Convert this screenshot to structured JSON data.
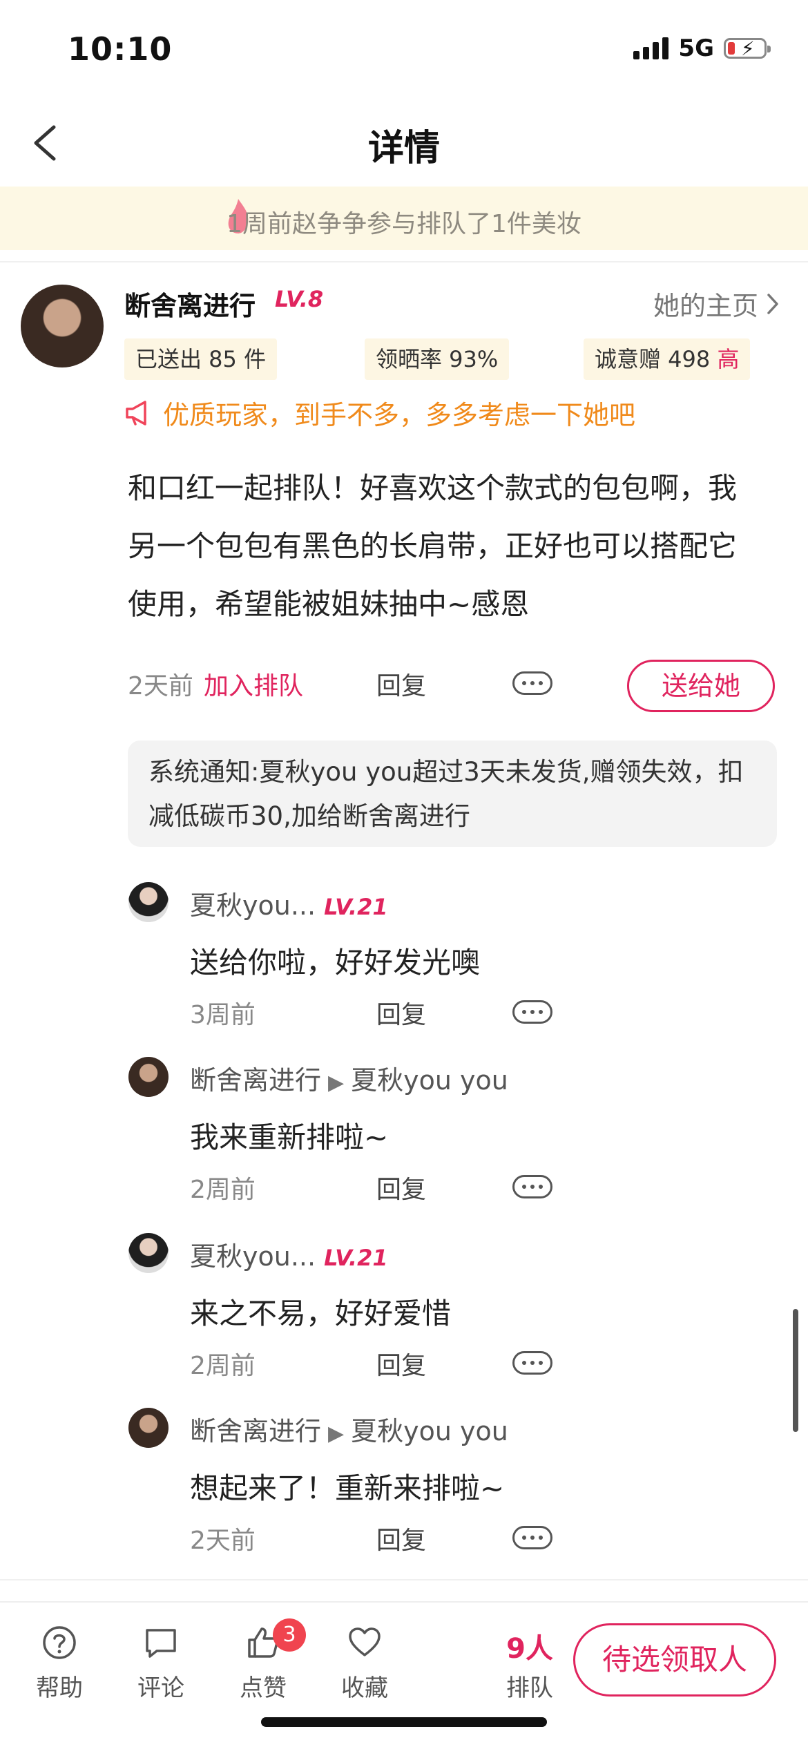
{
  "status_bar": {
    "time": "10:10",
    "network": "5G"
  },
  "nav": {
    "title": "详情"
  },
  "banner": {
    "text": "1周前赵争争参与排队了1件美妆"
  },
  "user": {
    "name": "断舍离进行",
    "level": "LV.8",
    "homepage_label": "她的主页",
    "stats": {
      "sent": "已送出 85 件",
      "review_rate": "领晒率 93%",
      "sincerity": "诚意赠 498",
      "sincerity_level": "高"
    },
    "tip": "优质玩家，到手不多，多多考虑一下她吧"
  },
  "post": {
    "text": "和口红一起排队！好喜欢这个款式的包包啊，我另一个包包有黑色的长肩带，正好也可以搭配它使用，希望能被姐妹抽中~感恩",
    "time": "2天前",
    "join_label": "加入排队",
    "reply_label": "回复",
    "send_button": "送给她"
  },
  "system_notice": "系统通知:夏秋you you超过3天未发货,赠领失效，扣减低碳币30,加给断舍离进行",
  "replies": [
    {
      "name": "夏秋you...",
      "level": "LV.21",
      "target": "",
      "text": "送给你啦，好好发光噢",
      "time": "3周前",
      "reply_label": "回复"
    },
    {
      "name": "断舍离进行",
      "level": "",
      "target": "夏秋you you",
      "text": "我来重新排啦~",
      "time": "2周前",
      "reply_label": "回复"
    },
    {
      "name": "夏秋you...",
      "level": "LV.21",
      "target": "",
      "text": "来之不易，好好爱惜",
      "time": "2周前",
      "reply_label": "回复"
    },
    {
      "name": "断舍离进行",
      "level": "",
      "target": "夏秋you you",
      "text": "想起来了！重新来排啦~",
      "time": "2天前",
      "reply_label": "回复"
    }
  ],
  "bottom_bar": {
    "help": "帮助",
    "comment": "评论",
    "like": "点赞",
    "like_badge": "3",
    "favorite": "收藏",
    "queue_count": "9人",
    "queue_label": "排队",
    "claim_button": "待选领取人"
  },
  "colors": {
    "accent": "#e0245e",
    "tip": "#f08a1b",
    "banner_bg": "#fdf8e4",
    "chip_bg": "#fdf6e3",
    "badge": "#f0444f"
  },
  "icons": [
    "chevron-left-icon",
    "flame-icon",
    "megaphone-icon",
    "chevron-right-icon",
    "more-icon",
    "help-icon",
    "comment-icon",
    "thumbs-up-icon",
    "heart-icon"
  ]
}
